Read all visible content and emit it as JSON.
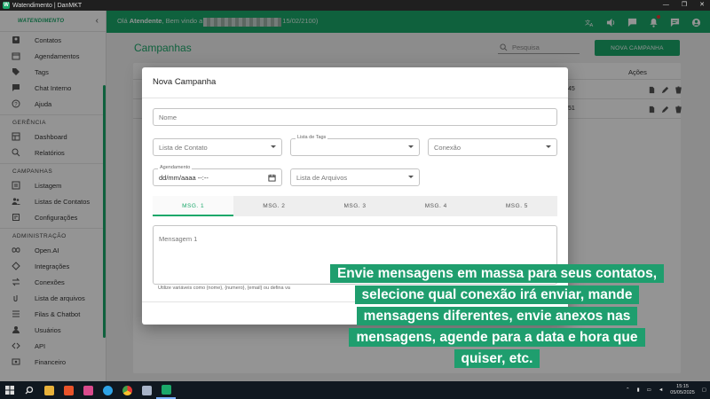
{
  "window": {
    "title": "Watendimento | DanMKT",
    "controls": [
      "—",
      "❐",
      "✕"
    ]
  },
  "sidebar": {
    "logo": "WATENDIMENTO",
    "items_top": [
      {
        "label": "Contatos",
        "icon": "contacts-icon"
      },
      {
        "label": "Agendamentos",
        "icon": "calendar-icon"
      },
      {
        "label": "Tags",
        "icon": "tag-icon"
      },
      {
        "label": "Chat Interno",
        "icon": "chat-icon"
      },
      {
        "label": "Ajuda",
        "icon": "help-icon"
      }
    ],
    "section_gerencia": "GERÊNCIA",
    "items_gerencia": [
      {
        "label": "Dashboard",
        "icon": "dashboard-icon"
      },
      {
        "label": "Relatórios",
        "icon": "search-icon"
      }
    ],
    "section_campanhas": "CAMPANHAS",
    "items_campanhas": [
      {
        "label": "Listagem",
        "icon": "list-icon"
      },
      {
        "label": "Listas de Contatos",
        "icon": "people-icon"
      },
      {
        "label": "Configurações",
        "icon": "settings-icon"
      }
    ],
    "section_admin": "ADMINISTRAÇÃO",
    "items_admin": [
      {
        "label": "Open.AI",
        "icon": "infinity-icon"
      },
      {
        "label": "Integrações",
        "icon": "integration-icon"
      },
      {
        "label": "Conexões",
        "icon": "swap-icon"
      },
      {
        "label": "Lista de arquivos",
        "icon": "attach-icon"
      },
      {
        "label": "Filas & Chatbot",
        "icon": "queue-icon"
      },
      {
        "label": "Usuários",
        "icon": "users-icon"
      },
      {
        "label": "API",
        "icon": "code-icon"
      },
      {
        "label": "Financeiro",
        "icon": "money-icon"
      }
    ]
  },
  "appbar": {
    "greeting_prefix": "Olá ",
    "user": "Atendente",
    "greeting_mid": ", Bem vindo a",
    "greeting_suffix": "15/02/2100)"
  },
  "main": {
    "title": "Campanhas",
    "search_placeholder": "Pesquisa",
    "new_button": "NOVA CAMPANHA",
    "col_actions": "Ações",
    "row1_fragment": ":45",
    "row2_fragment": ":51"
  },
  "modal": {
    "title": "Nova Campanha",
    "name_placeholder": "Nome",
    "contact_list_placeholder": "Lista de Contato",
    "tags_label": "Lista de Tags",
    "connection_placeholder": "Conexão",
    "schedule_label": "Agendamento",
    "schedule_value": "dd/mm/aaaa --:--",
    "files_placeholder": "Lista de Arquivos",
    "tabs": [
      "MSG. 1",
      "MSG. 2",
      "MSG. 3",
      "MSG. 4",
      "MSG. 5"
    ],
    "active_tab": 0,
    "message_placeholder": "Mensagem 1",
    "hint": "Utilize variáveis como {nome}, {numero}, {email} ou defina va"
  },
  "caption": {
    "lines": [
      "Envie mensagens em massa para seus contatos,",
      "selecione qual conexão irá enviar, mande",
      "mensagens diferentes, envie anexos nas",
      "mensagens, agende para a data e hora que",
      "quiser, etc."
    ]
  },
  "taskbar": {
    "time": "15:15",
    "date": "05/05/2025"
  },
  "colors": {
    "brand": "#1ba86a",
    "caption_bg": "#1f9e6e"
  }
}
